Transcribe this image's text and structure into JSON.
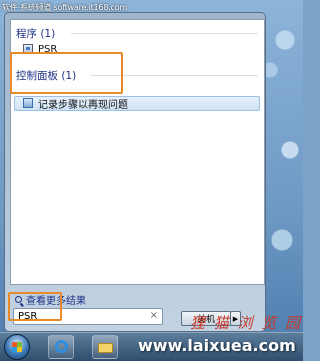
{
  "watermark_top": "软件·系统频道  software.it168.com",
  "sections": [
    {
      "header": "程序 (1)",
      "items": [
        {
          "label": "PSR",
          "icon": "psr-app-icon"
        }
      ]
    },
    {
      "header": "控制面板 (1)",
      "items": [
        {
          "label": "记录步骤以再现问题",
          "icon": "control-panel-icon"
        }
      ]
    }
  ],
  "see_more": "查看更多结果",
  "search": {
    "value": "PSR",
    "clear_glyph": "×"
  },
  "shutdown": {
    "label": "关机",
    "arrow": "▶"
  },
  "site": {
    "cn": "狸 猫 浏 览 园",
    "url": "www.laixuea.com"
  },
  "colors": {
    "highlight_box": "#e8892c",
    "link": "#1e3287"
  }
}
